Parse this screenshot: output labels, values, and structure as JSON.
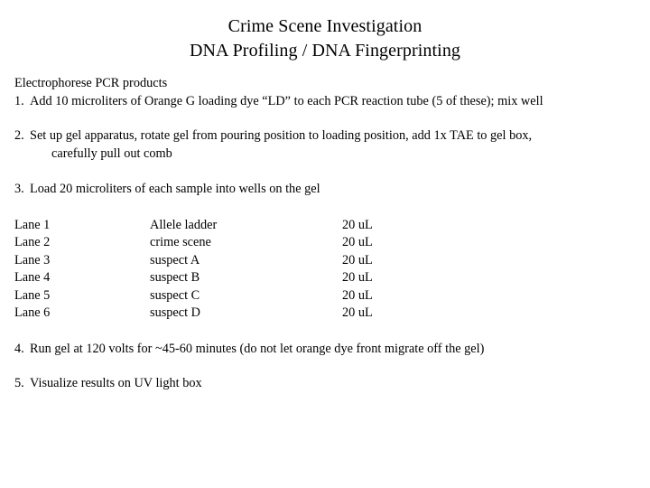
{
  "slide": {
    "title_lines": [
      "Crime Scene Investigation",
      "DNA Profiling / DNA Fingerprinting"
    ],
    "lead": "Electrophorese PCR products",
    "steps": [
      {
        "number": "1.",
        "text": "Add 10 microliters of Orange G loading dye “LD” to each PCR reaction tube (5 of these); mix well"
      },
      {
        "number": "2.",
        "text": "Set up gel apparatus, rotate gel from pouring position to loading position, add 1x TAE to gel box,",
        "continuation": "carefully pull out comb"
      },
      {
        "number": "3.",
        "text": "Load 20 microliters of each sample into wells on the gel"
      },
      {
        "number": "4.",
        "text": "Run gel at 120 volts for ~45-60 minutes (do not let orange dye front migrate off the gel)"
      },
      {
        "number": "5.",
        "text": "Visualize results on UV light box"
      }
    ],
    "lane_table": {
      "rows": [
        {
          "lane": "Lane 1",
          "sample": "Allele ladder",
          "volume": "20 uL"
        },
        {
          "lane": "Lane 2",
          "sample": "crime scene",
          "volume": "20 uL"
        },
        {
          "lane": "Lane 3",
          "sample": "suspect A",
          "volume": "20 uL"
        },
        {
          "lane": "Lane 4",
          "sample": "suspect B",
          "volume": "20 uL"
        },
        {
          "lane": "Lane 5",
          "sample": "suspect C",
          "volume": "20 uL"
        },
        {
          "lane": "Lane 6",
          "sample": "suspect D",
          "volume": "20 uL"
        }
      ]
    },
    "colors": {
      "background": "#ffffff",
      "text": "#000000"
    }
  }
}
